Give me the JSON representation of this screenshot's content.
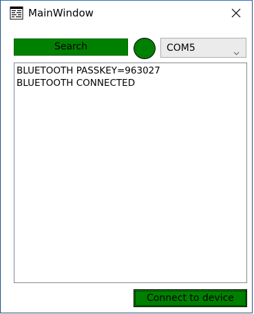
{
  "window": {
    "title": "MainWindow",
    "app_icon": "window-app-icon",
    "close_icon": "close-icon"
  },
  "toolbar": {
    "search_label": "Search",
    "status_light": {
      "icon": "status-indicator-circle",
      "color": "#008000"
    },
    "port_select": {
      "selected": "COM5",
      "chevron_icon": "chevron-down-icon"
    }
  },
  "log": {
    "lines": [
      "BLUETOOTH PASSKEY=963027",
      "BLUETOOTH CONNECTED"
    ]
  },
  "footer": {
    "connect_label": "Connect to device"
  },
  "colors": {
    "accent_green": "#008000",
    "window_border": "#1f4e79"
  }
}
